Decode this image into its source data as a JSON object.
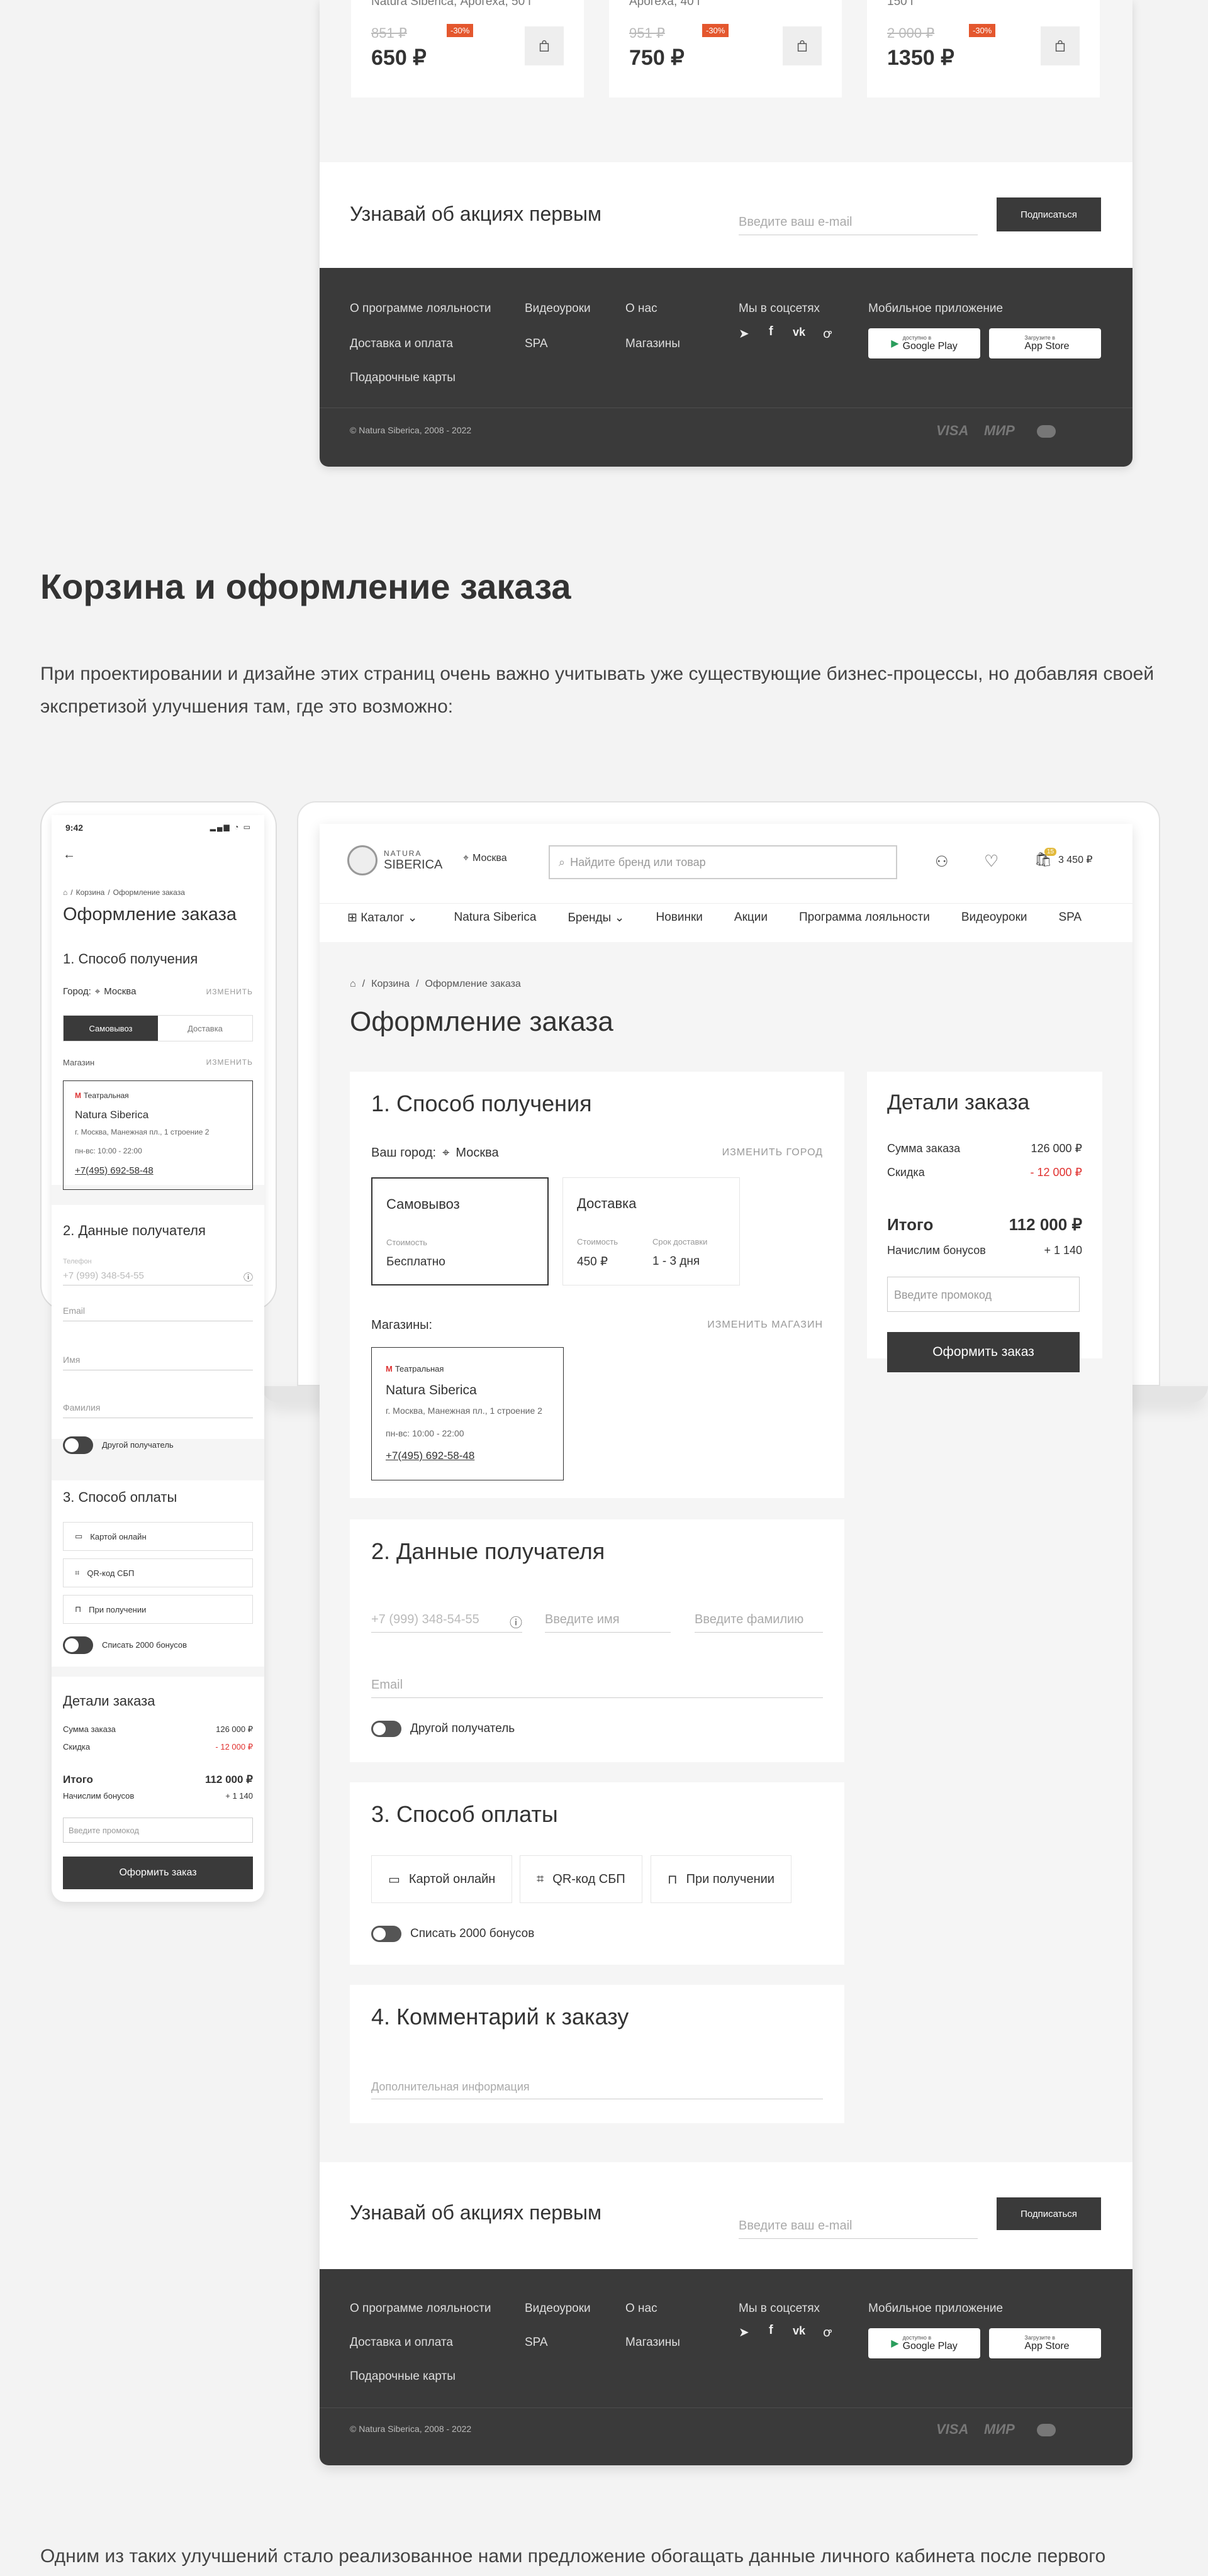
{
  "top_products": [
    {
      "name": "Natura Siberica, Арогеxа, 50 г",
      "old": "851 ₽",
      "disc": "-30%",
      "price": "650 ₽"
    },
    {
      "name": "Арогеxа, 40 г",
      "old": "951 ₽",
      "disc": "-30%",
      "price": "750 ₽"
    },
    {
      "name": "150 г",
      "old": "2 000 ₽",
      "disc": "-30%",
      "price": "1350 ₽"
    }
  ],
  "subscribe": {
    "title": "Узнавай об акциях первым",
    "placeholder": "Введите ваш e-mail",
    "button": "Подписаться"
  },
  "footer": {
    "links": [
      [
        "О программе лояльности",
        "Доставка и оплата",
        "Подарочные карты"
      ],
      [
        "Видеоуроки",
        "SPA"
      ],
      [
        "О нас",
        "Магазины"
      ]
    ],
    "social_title": "Мы в соцсетях",
    "app_title": "Мобильное приложение",
    "google_small": "доступно в",
    "google": "Google Play",
    "apple_small": "Загрузите в",
    "apple": "App Store",
    "copyright": "© Natura Siberica, 2008 - 2022",
    "pay": [
      "VISA",
      "МИР"
    ]
  },
  "article": {
    "heading": "Корзина и оформление заказа",
    "p1": "При проектировании и дизайне этих страниц очень важно учитывать уже существующие бизнес-процессы, но добавляя своей экспретизой улучшения там, где это возможно:",
    "p2": "Одним из таких улучшений стало реализованное нами предложение обогащать данные личного кабинета после первого"
  },
  "desktop": {
    "logo_top": "NATURA",
    "logo_bottom": "SIBERICA",
    "city": "Москва",
    "search_placeholder": "Найдите бренд или товар",
    "cart_count": "15",
    "cart_total": "3 450 ₽",
    "nav": [
      "Каталог",
      "Natura Siberica",
      "Бренды",
      "Новинки",
      "Акции",
      "Программа лояльности",
      "Видеоуроки",
      "SPA"
    ],
    "breadcrumb": [
      "Корзина",
      "Оформление заказа"
    ],
    "page_title": "Оформление заказа",
    "s1": {
      "title": "1. Способ получения",
      "city_label": "Ваш город:",
      "city": "Москва",
      "change_city": "ИЗМЕНИТЬ ГОРОД",
      "pickup": {
        "title": "Самовывоз",
        "cost_label": "Стоимость",
        "cost": "Бесплатно"
      },
      "delivery": {
        "title": "Доставка",
        "cost_label": "Стоимость",
        "cost": "450 ₽",
        "term_label": "Срок доставки",
        "term": "1 - 3 дня"
      },
      "stores_label": "Магазины:",
      "change_store": "ИЗМЕНИТЬ МАГАЗИН",
      "store": {
        "metro": "Театральная",
        "name": "Natura Siberica",
        "address": "г. Москва, Манежная пл., 1 строение 2",
        "hours": "пн-вс: 10:00 - 22:00",
        "phone": "+7(495) 692-58-48"
      }
    },
    "s2": {
      "title": "2. Данные получателя",
      "phone": "+7 (999) 348-54-55",
      "name": "Введите имя",
      "surname": "Введите фамилию",
      "email": "Email",
      "other": "Другой получатель"
    },
    "s3": {
      "title": "3. Способ оплаты",
      "options": [
        "Картой онлайн",
        "QR-код СБП",
        "При получении"
      ],
      "bonus": "Списать 2000 бонусов"
    },
    "s4": {
      "title": "4. Комментарий к заказу",
      "placeholder": "Дополнительная информация"
    },
    "summary": {
      "title": "Детали заказа",
      "sum_label": "Сумма заказа",
      "sum": "126 000 ₽",
      "disc_label": "Скидка",
      "disc": "- 12 000 ₽",
      "total_label": "Итого",
      "total": "112 000 ₽",
      "bonus_label": "Начислим бонусов",
      "bonus": "+ 1 140",
      "promo": "Введите промокод",
      "button": "Оформить заказ"
    }
  },
  "mobile": {
    "time": "9:42",
    "breadcrumb": [
      "Корзина",
      "Оформление заказа"
    ],
    "page_title": "Оформление заказа",
    "s1_title": "1. Способ получения",
    "city_label": "Город:",
    "city": "Москва",
    "change": "ИЗМЕНИТЬ",
    "tabs": [
      "Самовывоз",
      "Доставка"
    ],
    "stores_label": "Магазин",
    "change2": "ИЗМЕНИТЬ",
    "store": {
      "metro": "Театральная",
      "name": "Natura Siberica",
      "address": "г. Москва, Манежная пл., 1 строение 2",
      "hours": "пн-вс: 10:00 - 22:00",
      "phone": "+7(495) 692-58-48"
    },
    "s2_title": "2. Данные получателя",
    "phone_label": "Телефон",
    "phone": "+7 (999) 348-54-55",
    "email": "Email",
    "name": "Имя",
    "surname": "Фамилия",
    "other": "Другой получатель",
    "s3_title": "3. Способ оплаты",
    "pay": [
      "Картой онлайн",
      "QR-код СБП",
      "При получении"
    ],
    "bonus": "Списать 2000 бонусов",
    "sum_title": "Детали заказа",
    "sum_label": "Сумма заказа",
    "sum": "126 000 ₽",
    "disc_label": "Скидка",
    "disc": "- 12 000 ₽",
    "total_label": "Итого",
    "total": "112 000 ₽",
    "bonus_label": "Начислим бонусов",
    "bonus_val": "+ 1 140",
    "promo": "Введите промокод",
    "button": "Оформить заказ"
  }
}
